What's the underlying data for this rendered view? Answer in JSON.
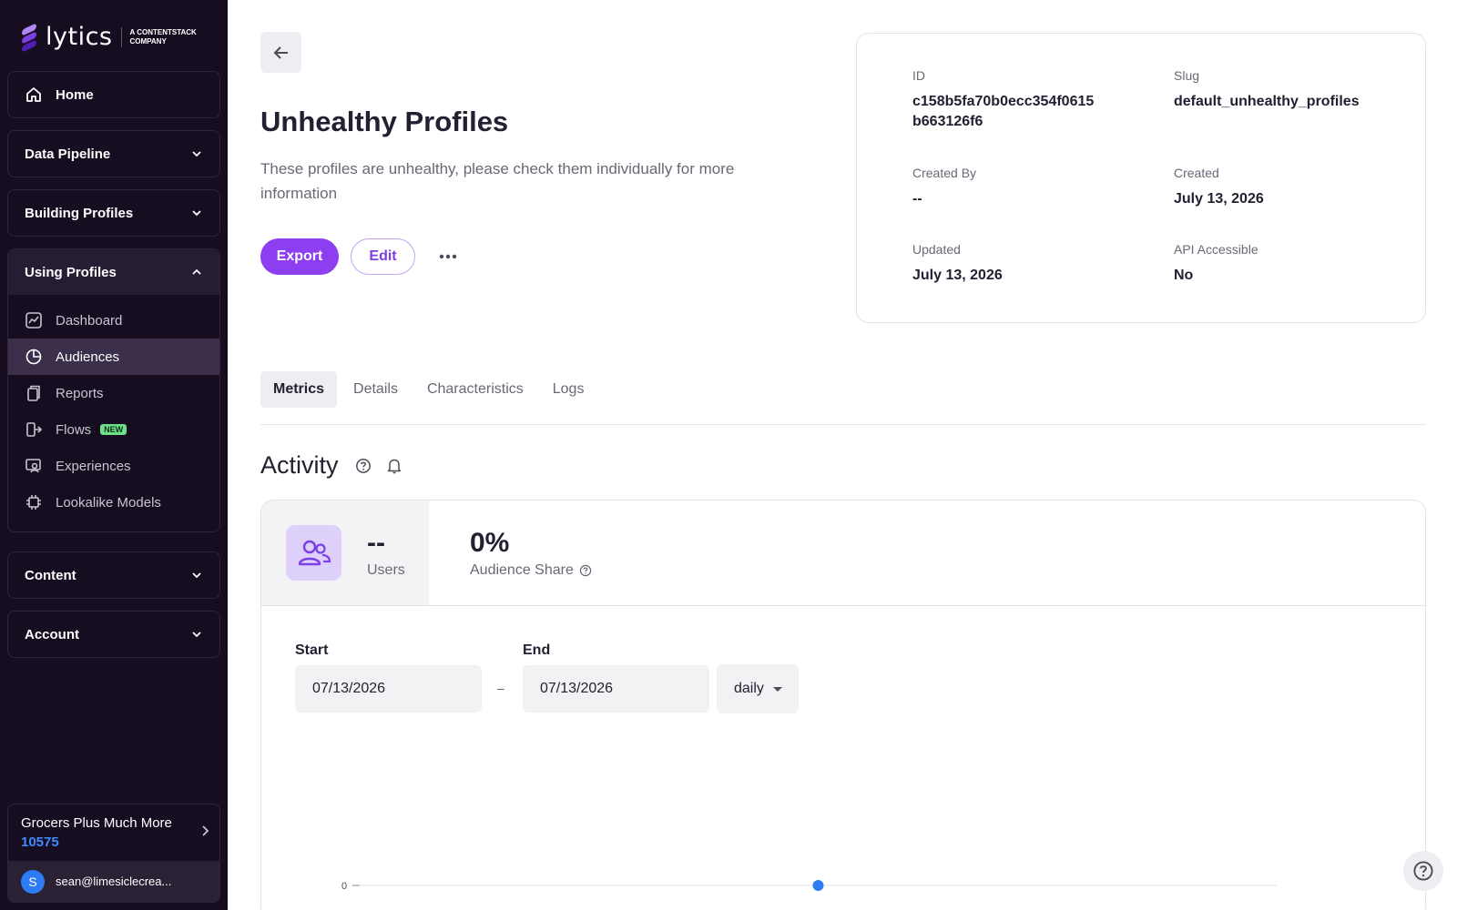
{
  "brand": {
    "name": "lytics",
    "tagline": "A CONTENTSTACK COMPANY",
    "accent": "#8c3ef0"
  },
  "sidebar": {
    "home": "Home",
    "sections": [
      {
        "label": "Data Pipeline"
      },
      {
        "label": "Building Profiles"
      },
      {
        "label": "Using Profiles"
      },
      {
        "label": "Content"
      },
      {
        "label": "Account"
      }
    ],
    "using_profiles_items": [
      {
        "label": "Dashboard",
        "icon": "chart-icon"
      },
      {
        "label": "Audiences",
        "icon": "pie-icon",
        "active": true
      },
      {
        "label": "Reports",
        "icon": "clipboard-icon"
      },
      {
        "label": "Flows",
        "icon": "flow-icon",
        "badge": "NEW"
      },
      {
        "label": "Experiences",
        "icon": "experience-icon"
      },
      {
        "label": "Lookalike Models",
        "icon": "chip-icon"
      }
    ],
    "org": {
      "name": "Grocers Plus Much More",
      "id": "10575"
    },
    "user": {
      "initial": "S",
      "email": "sean@limesiclecrea..."
    }
  },
  "page": {
    "title": "Unhealthy Profiles",
    "description": "These profiles are unhealthy, please check them individually for more information",
    "export_label": "Export",
    "edit_label": "Edit",
    "more_label": "•••"
  },
  "info": {
    "id_label": "ID",
    "id_value": "c158b5fa70b0ecc354f0615 b663126f6",
    "slug_label": "Slug",
    "slug_value": "default_unhealthy_profiles",
    "created_by_label": "Created By",
    "created_by_value": "--",
    "created_label": "Created",
    "created_value": "July 13, 2026",
    "updated_label": "Updated",
    "updated_value": "July 13, 2026",
    "api_label": "API Accessible",
    "api_value": "No"
  },
  "tabs": [
    "Metrics",
    "Details",
    "Characteristics",
    "Logs"
  ],
  "activity": {
    "title": "Activity",
    "users_value": "--",
    "users_label": "Users",
    "share_value": "0%",
    "share_label": "Audience Share",
    "start_label": "Start",
    "start_value": "07/13/2026",
    "end_label": "End",
    "end_value": "07/13/2026",
    "range_sep": "–",
    "interval": "daily"
  },
  "chart_data": {
    "type": "line",
    "x": [
      "07/13/2026"
    ],
    "series": [
      {
        "values": [
          0
        ]
      }
    ],
    "ytick_labels": [
      "0"
    ]
  }
}
